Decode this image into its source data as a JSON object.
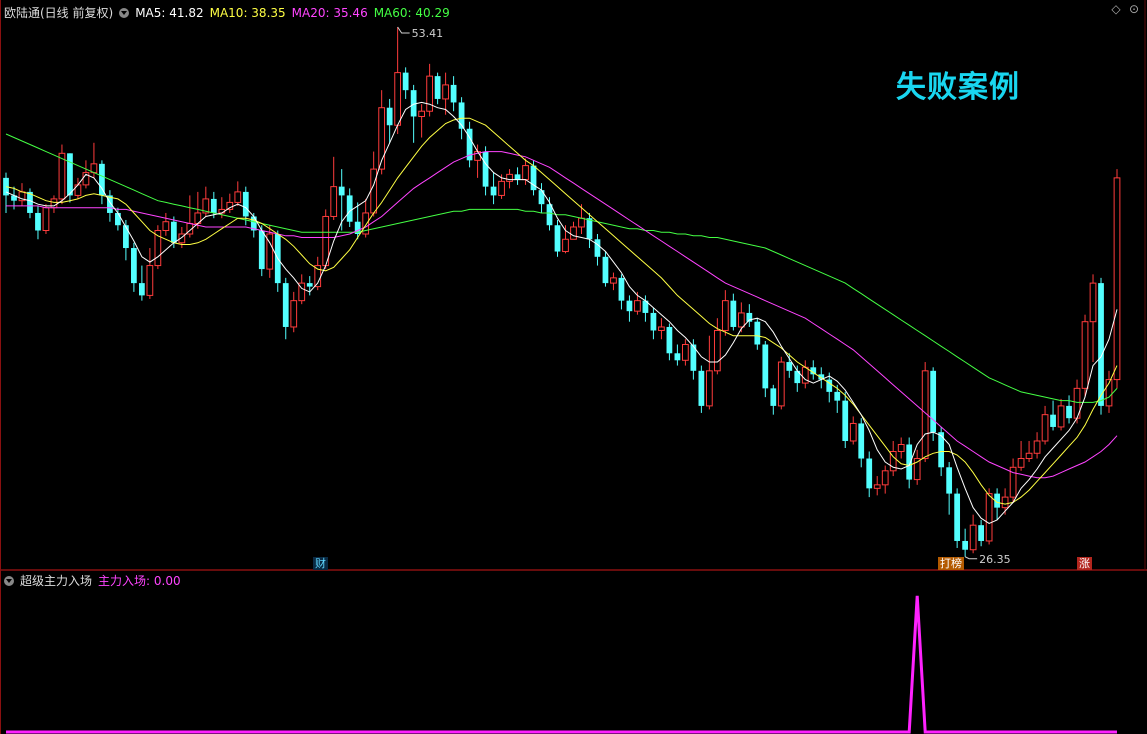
{
  "header": {
    "stock_title": "欧陆通(日线 前复权)",
    "ma5": "MA5: 41.82",
    "ma10": "MA10: 38.35",
    "ma20": "MA20: 35.46",
    "ma60": "MA60: 40.29"
  },
  "watermark": "失败案例",
  "annotations": {
    "high": "53.41",
    "low": "26.35"
  },
  "tags": {
    "cai": "财",
    "baobang": "打榜",
    "zhang": "涨"
  },
  "indicator": {
    "name": "超级主力入场",
    "value_label": "主力入场: 0.00"
  },
  "colors": {
    "up": "#ff3c3c",
    "down": "#53ffff",
    "ma5": "#ffffff",
    "ma10": "#ffff44",
    "ma20": "#ff44ff",
    "ma60": "#44ff44",
    "indicator": "#ff22ff",
    "border": "#8a1010"
  },
  "icons": [
    "collapse-icon",
    "diamond-icon",
    "target-icon"
  ],
  "chart_data": {
    "type": "candlestick",
    "ylim": [
      24.5,
      55
    ],
    "candles": [
      [
        46.0,
        45.0,
        46.3,
        44.0
      ],
      [
        45.0,
        44.7,
        45.5,
        44.2
      ],
      [
        44.7,
        45.2,
        45.7,
        44.4
      ],
      [
        45.2,
        44.0,
        45.4,
        43.7
      ],
      [
        44.0,
        43.0,
        44.4,
        42.5
      ],
      [
        43.0,
        44.3,
        44.5,
        42.8
      ],
      [
        44.3,
        44.8,
        45.0,
        44.0
      ],
      [
        44.8,
        47.4,
        47.9,
        44.5
      ],
      [
        47.4,
        45.0,
        47.4,
        44.6
      ],
      [
        45.0,
        45.6,
        46.0,
        44.8
      ],
      [
        45.6,
        46.3,
        47.0,
        45.4
      ],
      [
        46.3,
        46.8,
        48.0,
        46.0
      ],
      [
        46.8,
        45.0,
        47.0,
        44.5
      ],
      [
        45.0,
        44.0,
        45.3,
        43.5
      ],
      [
        44.0,
        43.3,
        44.3,
        43.0
      ],
      [
        43.3,
        42.0,
        43.6,
        41.3
      ],
      [
        42.0,
        40.0,
        42.3,
        39.5
      ],
      [
        40.0,
        39.3,
        41.0,
        39.0
      ],
      [
        39.3,
        41.0,
        42.0,
        39.1
      ],
      [
        41.0,
        43.0,
        43.3,
        40.8
      ],
      [
        43.0,
        43.5,
        44.0,
        42.7
      ],
      [
        43.5,
        42.3,
        43.8,
        42.0
      ],
      [
        42.3,
        42.8,
        43.2,
        42.0
      ],
      [
        42.8,
        43.4,
        45.0,
        42.6
      ],
      [
        43.4,
        44.0,
        45.2,
        43.1
      ],
      [
        44.0,
        44.8,
        45.5,
        43.8
      ],
      [
        44.8,
        44.0,
        45.2,
        43.7
      ],
      [
        44.0,
        44.2,
        44.9,
        43.7
      ],
      [
        44.2,
        44.6,
        45.1,
        44.0
      ],
      [
        44.6,
        45.2,
        45.8,
        44.4
      ],
      [
        45.2,
        43.8,
        45.5,
        43.3
      ],
      [
        43.8,
        43.0,
        44.0,
        42.6
      ],
      [
        43.0,
        40.8,
        43.3,
        40.4
      ],
      [
        40.8,
        42.8,
        43.3,
        40.3
      ],
      [
        42.8,
        40.0,
        43.0,
        39.5
      ],
      [
        40.0,
        37.5,
        40.3,
        36.8
      ],
      [
        37.5,
        39.0,
        39.5,
        37.2
      ],
      [
        39.0,
        40.0,
        40.5,
        38.8
      ],
      [
        40.0,
        39.8,
        40.4,
        39.3
      ],
      [
        39.8,
        41.0,
        41.5,
        39.6
      ],
      [
        41.0,
        43.8,
        44.2,
        40.8
      ],
      [
        43.8,
        45.5,
        47.2,
        43.6
      ],
      [
        45.5,
        45.0,
        46.5,
        43.0
      ],
      [
        45.0,
        43.5,
        45.4,
        43.2
      ],
      [
        43.5,
        42.8,
        44.6,
        42.5
      ],
      [
        42.8,
        44.0,
        44.8,
        42.6
      ],
      [
        44.0,
        46.5,
        47.5,
        43.8
      ],
      [
        46.5,
        50.0,
        51.0,
        46.2
      ],
      [
        50.0,
        49.0,
        50.5,
        48.0
      ],
      [
        49.0,
        52.0,
        54.6,
        48.5
      ],
      [
        52.0,
        51.0,
        52.3,
        50.5
      ],
      [
        51.0,
        49.5,
        51.3,
        48.0
      ],
      [
        49.5,
        49.8,
        50.2,
        48.3
      ],
      [
        49.8,
        51.8,
        52.5,
        49.5
      ],
      [
        51.8,
        50.5,
        52.0,
        50.2
      ],
      [
        50.5,
        51.3,
        52.0,
        49.6
      ],
      [
        51.3,
        50.3,
        51.8,
        49.8
      ],
      [
        50.3,
        48.8,
        50.6,
        48.2
      ],
      [
        48.8,
        47.0,
        49.2,
        46.6
      ],
      [
        47.0,
        47.5,
        47.9,
        46.0
      ],
      [
        47.5,
        45.5,
        47.8,
        45.0
      ],
      [
        45.5,
        45.0,
        46.3,
        44.5
      ],
      [
        45.0,
        45.8,
        46.2,
        44.8
      ],
      [
        45.8,
        46.2,
        46.5,
        45.4
      ],
      [
        46.2,
        45.9,
        46.6,
        45.6
      ],
      [
        45.9,
        46.7,
        47.1,
        45.6
      ],
      [
        46.7,
        45.3,
        47.0,
        45.0
      ],
      [
        45.3,
        44.5,
        45.7,
        44.0
      ],
      [
        44.5,
        43.3,
        44.9,
        43.0
      ],
      [
        43.3,
        41.8,
        43.6,
        41.5
      ],
      [
        41.8,
        42.5,
        43.3,
        41.7
      ],
      [
        42.5,
        43.2,
        43.5,
        42.6
      ],
      [
        43.2,
        43.7,
        44.5,
        42.8
      ],
      [
        43.7,
        42.5,
        44.0,
        42.0
      ],
      [
        42.5,
        41.5,
        42.8,
        41.0
      ],
      [
        41.5,
        40.0,
        41.8,
        39.8
      ],
      [
        40.0,
        40.3,
        40.6,
        39.6
      ],
      [
        40.3,
        39.0,
        40.5,
        38.5
      ],
      [
        39.0,
        38.4,
        39.3,
        37.8
      ],
      [
        38.4,
        39.0,
        39.5,
        38.2
      ],
      [
        39.0,
        38.3,
        39.3,
        37.8
      ],
      [
        38.3,
        37.3,
        38.6,
        36.8
      ],
      [
        37.3,
        37.5,
        38.0,
        36.8
      ],
      [
        37.5,
        36.0,
        37.7,
        35.6
      ],
      [
        36.0,
        35.6,
        36.5,
        35.3
      ],
      [
        35.6,
        36.5,
        36.8,
        35.3
      ],
      [
        36.5,
        35.0,
        36.8,
        34.5
      ],
      [
        35.0,
        33.0,
        35.3,
        32.6
      ],
      [
        33.0,
        35.0,
        37.0,
        32.8
      ],
      [
        35.0,
        37.3,
        38.0,
        34.8
      ],
      [
        37.3,
        39.0,
        39.6,
        37.0
      ],
      [
        39.0,
        37.5,
        39.4,
        37.3
      ],
      [
        37.5,
        38.3,
        38.9,
        37.2
      ],
      [
        38.3,
        37.8,
        38.8,
        37.5
      ],
      [
        37.8,
        36.5,
        38.0,
        36.2
      ],
      [
        36.5,
        34.0,
        36.7,
        33.5
      ],
      [
        34.0,
        33.0,
        34.2,
        32.5
      ],
      [
        33.0,
        35.5,
        35.8,
        32.8
      ],
      [
        35.5,
        35.0,
        36.0,
        34.6
      ],
      [
        35.0,
        34.3,
        35.3,
        33.8
      ],
      [
        34.3,
        35.2,
        35.6,
        34.0
      ],
      [
        35.2,
        34.8,
        35.6,
        34.5
      ],
      [
        34.8,
        34.5,
        35.2,
        34.0
      ],
      [
        34.5,
        33.8,
        34.9,
        33.2
      ],
      [
        33.8,
        33.3,
        34.2,
        32.6
      ],
      [
        33.3,
        31.0,
        33.8,
        30.6
      ],
      [
        31.0,
        32.0,
        32.4,
        30.8
      ],
      [
        32.0,
        30.0,
        32.3,
        29.5
      ],
      [
        30.0,
        28.3,
        30.4,
        27.8
      ],
      [
        28.3,
        28.5,
        29.0,
        27.9
      ],
      [
        28.5,
        29.3,
        29.6,
        28.0
      ],
      [
        29.3,
        30.4,
        31.0,
        29.0
      ],
      [
        30.4,
        30.8,
        31.2,
        30.0
      ],
      [
        30.8,
        28.8,
        31.2,
        28.3
      ],
      [
        28.8,
        30.0,
        30.5,
        28.5
      ],
      [
        30.0,
        35.0,
        35.5,
        29.8
      ],
      [
        35.0,
        31.5,
        35.2,
        31.0
      ],
      [
        31.5,
        29.5,
        31.8,
        29.0
      ],
      [
        29.5,
        28.0,
        29.8,
        26.8
      ],
      [
        28.0,
        25.3,
        28.3,
        24.9
      ],
      [
        25.3,
        24.8,
        26.0,
        24.4
      ],
      [
        24.8,
        26.2,
        26.8,
        24.6
      ],
      [
        26.2,
        25.3,
        26.5,
        25.0
      ],
      [
        25.3,
        28.0,
        28.3,
        25.1
      ],
      [
        28.0,
        27.2,
        28.3,
        26.5
      ],
      [
        27.2,
        27.8,
        28.3,
        26.8
      ],
      [
        27.8,
        29.5,
        30.0,
        27.5
      ],
      [
        29.5,
        30.0,
        31.0,
        29.3
      ],
      [
        30.0,
        30.3,
        31.0,
        29.8
      ],
      [
        30.3,
        31.0,
        31.5,
        30.0
      ],
      [
        31.0,
        32.5,
        33.0,
        30.8
      ],
      [
        32.5,
        31.8,
        33.3,
        31.6
      ],
      [
        31.8,
        33.0,
        33.4,
        31.6
      ],
      [
        33.0,
        32.3,
        33.6,
        32.0
      ],
      [
        32.3,
        34.0,
        34.5,
        32.0
      ],
      [
        34.0,
        37.8,
        38.2,
        33.5
      ],
      [
        37.8,
        40.0,
        40.5,
        35.5
      ],
      [
        40.0,
        33.0,
        40.3,
        32.5
      ],
      [
        33.0,
        34.5,
        35.0,
        32.6
      ],
      [
        34.5,
        46.0,
        46.5,
        34.0
      ]
    ],
    "ma5": [
      45.2,
      45.0,
      44.8,
      44.7,
      44.5,
      44.4,
      44.4,
      44.7,
      45.1,
      45.6,
      46.2,
      46.0,
      45.4,
      44.6,
      44.0,
      43.2,
      42.4,
      41.5,
      41.2,
      41.5,
      41.9,
      42.3,
      42.6,
      43.0,
      43.4,
      43.8,
      43.9,
      44.0,
      44.3,
      44.5,
      44.3,
      43.8,
      43.0,
      42.3,
      41.4,
      40.8,
      40.3,
      39.7,
      39.5,
      40.0,
      41.0,
      42.4,
      43.5,
      44.1,
      44.4,
      44.7,
      45.6,
      47.0,
      48.0,
      49.0,
      49.9,
      50.2,
      50.3,
      50.2,
      50.0,
      49.9,
      49.5,
      49.0,
      48.3,
      47.5,
      46.8,
      46.3,
      46.0,
      45.9,
      45.9,
      45.9,
      45.6,
      45.3,
      44.6,
      43.7,
      43.0,
      42.7,
      42.6,
      42.5,
      42.2,
      41.8,
      41.2,
      40.6,
      39.8,
      39.3,
      39.0,
      38.6,
      38.2,
      37.8,
      37.3,
      36.9,
      36.4,
      35.8,
      35.5,
      35.5,
      35.9,
      36.6,
      37.4,
      37.9,
      38.0,
      37.8,
      37.2,
      36.4,
      35.7,
      35.0,
      34.5,
      34.3,
      34.5,
      34.7,
      34.4,
      33.9,
      33.2,
      32.5,
      31.6,
      30.5,
      29.8,
      29.5,
      29.4,
      29.6,
      30.8,
      31.4,
      31.5,
      31.3,
      30.8,
      29.5,
      28.3,
      27.2,
      26.6,
      26.3,
      26.5,
      27.0,
      27.5,
      28.3,
      28.8,
      29.4,
      30.1,
      30.6,
      31.1,
      31.6,
      32.3,
      33.5,
      35.3,
      35.8,
      36.8,
      38.5
    ],
    "ma10": [
      45.5,
      45.4,
      45.2,
      45.1,
      44.9,
      44.7,
      44.6,
      44.6,
      44.7,
      44.8,
      45.0,
      45.1,
      45.0,
      44.9,
      44.8,
      44.5,
      44.0,
      43.5,
      43.0,
      42.7,
      42.5,
      42.3,
      42.2,
      42.2,
      42.3,
      42.5,
      42.8,
      43.1,
      43.4,
      43.7,
      43.7,
      43.6,
      43.4,
      43.1,
      42.8,
      42.5,
      42.1,
      41.6,
      41.1,
      40.8,
      40.7,
      40.9,
      41.4,
      41.9,
      42.6,
      43.3,
      44.0,
      44.6,
      45.3,
      46.0,
      46.6,
      47.2,
      47.8,
      48.3,
      48.7,
      49.1,
      49.3,
      49.4,
      49.4,
      49.2,
      49.0,
      48.6,
      48.2,
      47.8,
      47.4,
      47.0,
      46.7,
      46.3,
      45.9,
      45.5,
      45.1,
      44.7,
      44.3,
      43.9,
      43.5,
      43.1,
      42.7,
      42.3,
      41.9,
      41.5,
      41.1,
      40.7,
      40.3,
      39.8,
      39.3,
      38.9,
      38.5,
      38.1,
      37.7,
      37.4,
      37.2,
      37.0,
      37.0,
      37.0,
      37.0,
      36.9,
      36.6,
      36.3,
      35.9,
      35.5,
      35.2,
      34.9,
      34.6,
      34.3,
      34.0,
      33.6,
      33.1,
      32.5,
      31.9,
      31.3,
      30.7,
      30.1,
      29.7,
      29.6,
      29.8,
      30.1,
      30.3,
      30.4,
      30.4,
      30.2,
      29.8,
      29.2,
      28.5,
      27.9,
      27.5,
      27.4,
      27.5,
      27.8,
      28.2,
      28.7,
      29.2,
      29.7,
      30.2,
      30.7,
      31.2,
      31.9,
      32.8,
      33.6,
      34.3,
      35.3
    ],
    "ma20": [
      44.4,
      44.4,
      44.4,
      44.4,
      44.4,
      44.3,
      44.3,
      44.3,
      44.3,
      44.3,
      44.3,
      44.3,
      44.3,
      44.3,
      44.2,
      44.2,
      44.1,
      44.0,
      43.9,
      43.8,
      43.7,
      43.6,
      43.5,
      43.4,
      43.3,
      43.2,
      43.2,
      43.2,
      43.2,
      43.2,
      43.2,
      43.1,
      43.0,
      42.9,
      42.8,
      42.7,
      42.7,
      42.6,
      42.6,
      42.6,
      42.6,
      42.6,
      42.7,
      42.8,
      43.0,
      43.2,
      43.5,
      43.8,
      44.2,
      44.6,
      45.0,
      45.4,
      45.7,
      46.0,
      46.3,
      46.6,
      46.9,
      47.1,
      47.3,
      47.4,
      47.5,
      47.5,
      47.5,
      47.4,
      47.3,
      47.2,
      47.0,
      46.8,
      46.6,
      46.3,
      46.0,
      45.7,
      45.4,
      45.1,
      44.8,
      44.5,
      44.2,
      43.9,
      43.6,
      43.3,
      43.0,
      42.7,
      42.4,
      42.1,
      41.8,
      41.5,
      41.2,
      40.9,
      40.6,
      40.3,
      40.0,
      39.8,
      39.6,
      39.4,
      39.2,
      39.0,
      38.8,
      38.6,
      38.4,
      38.2,
      38.0,
      37.7,
      37.4,
      37.1,
      36.8,
      36.5,
      36.2,
      35.8,
      35.4,
      35.0,
      34.6,
      34.2,
      33.8,
      33.4,
      33.0,
      32.6,
      32.2,
      31.8,
      31.4,
      31.0,
      30.7,
      30.4,
      30.1,
      29.8,
      29.6,
      29.4,
      29.2,
      29.1,
      29.0,
      28.9,
      28.9,
      29.0,
      29.2,
      29.4,
      29.6,
      29.8,
      30.1,
      30.4,
      30.8,
      31.3
    ],
    "ma60": [
      48.5,
      48.3,
      48.1,
      47.9,
      47.7,
      47.5,
      47.3,
      47.1,
      46.9,
      46.7,
      46.5,
      46.3,
      46.1,
      45.9,
      45.7,
      45.5,
      45.3,
      45.1,
      44.9,
      44.7,
      44.6,
      44.5,
      44.4,
      44.3,
      44.2,
      44.1,
      44.0,
      43.9,
      43.8,
      43.7,
      43.6,
      43.5,
      43.4,
      43.3,
      43.2,
      43.1,
      43.0,
      42.9,
      42.9,
      42.9,
      42.9,
      42.9,
      42.9,
      42.9,
      42.9,
      43.0,
      43.1,
      43.2,
      43.3,
      43.4,
      43.5,
      43.6,
      43.7,
      43.8,
      43.9,
      44.0,
      44.1,
      44.1,
      44.2,
      44.2,
      44.2,
      44.2,
      44.2,
      44.2,
      44.2,
      44.1,
      44.1,
      44.0,
      44.0,
      43.9,
      43.9,
      43.8,
      43.7,
      43.6,
      43.5,
      43.4,
      43.3,
      43.2,
      43.1,
      43.1,
      43.0,
      43.0,
      42.9,
      42.9,
      42.8,
      42.8,
      42.7,
      42.7,
      42.6,
      42.6,
      42.5,
      42.4,
      42.3,
      42.2,
      42.1,
      42.0,
      41.8,
      41.6,
      41.4,
      41.2,
      41.0,
      40.8,
      40.6,
      40.4,
      40.2,
      40.0,
      39.7,
      39.4,
      39.1,
      38.8,
      38.5,
      38.2,
      37.9,
      37.6,
      37.3,
      37.0,
      36.7,
      36.4,
      36.1,
      35.8,
      35.5,
      35.2,
      34.9,
      34.6,
      34.4,
      34.2,
      34.0,
      33.8,
      33.7,
      33.6,
      33.5,
      33.4,
      33.3,
      33.3,
      33.2,
      33.2,
      33.2,
      33.3,
      33.5,
      34.0
    ],
    "indicator": {
      "name": "主力入场",
      "values": [
        0,
        0,
        0,
        0,
        0,
        0,
        0,
        0,
        0,
        0,
        0,
        0,
        0,
        0,
        0,
        0,
        0,
        0,
        0,
        0,
        0,
        0,
        0,
        0,
        0,
        0,
        0,
        0,
        0,
        0,
        0,
        0,
        0,
        0,
        0,
        0,
        0,
        0,
        0,
        0,
        0,
        0,
        0,
        0,
        0,
        0,
        0,
        0,
        0,
        0,
        0,
        0,
        0,
        0,
        0,
        0,
        0,
        0,
        0,
        0,
        0,
        0,
        0,
        0,
        0,
        0,
        0,
        0,
        0,
        0,
        0,
        0,
        0,
        0,
        0,
        0,
        0,
        0,
        0,
        0,
        0,
        0,
        0,
        0,
        0,
        0,
        0,
        0,
        0,
        0,
        0,
        0,
        0,
        0,
        0,
        0,
        0,
        0,
        0,
        0,
        0,
        0,
        0,
        0,
        0,
        0,
        0,
        0,
        0,
        0,
        0,
        0,
        0,
        0,
        1,
        0,
        0,
        0,
        0,
        0,
        0,
        0,
        0,
        0,
        0,
        0,
        0,
        0,
        0,
        0,
        0,
        0,
        0,
        0,
        0,
        0,
        0,
        0,
        0,
        0
      ],
      "ylim": [
        0,
        1.05
      ]
    },
    "high_index": 49,
    "low_index": 120
  }
}
